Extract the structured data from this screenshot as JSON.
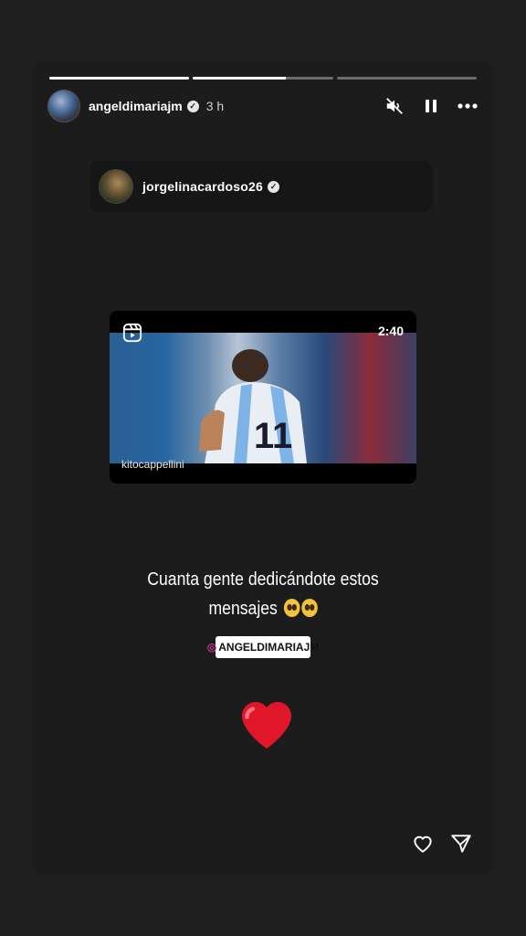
{
  "story": {
    "progress": [
      1,
      0.66,
      0
    ],
    "username": "angeldimariajm",
    "time": "3 h"
  },
  "repost": {
    "username": "jorgelinacardoso26"
  },
  "video": {
    "duration": "2:40",
    "credit": "kitocappellini"
  },
  "caption": {
    "line1": "Cuanta gente dedicándote estos",
    "line2": "mensajes"
  },
  "mention": {
    "label": "ANGELDIMARIAJM"
  },
  "icons": {
    "mute": "muted-speaker-icon",
    "pause": "pause-icon",
    "more": "more-icon",
    "reels": "reels-icon",
    "like": "heart-icon",
    "share": "send-icon",
    "sticker": "heart-emoji"
  },
  "colors": {
    "background": "#1e1e1e",
    "heart": "#e0162b"
  }
}
